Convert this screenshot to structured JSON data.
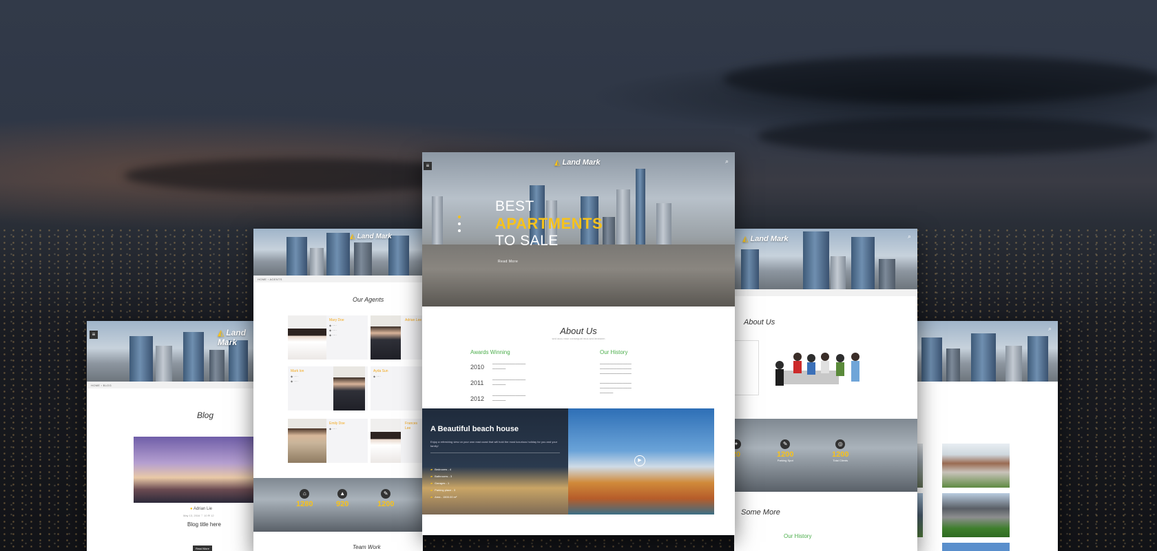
{
  "brand": {
    "name": "Land Mark",
    "accent": "#f7c21b",
    "green": "#4cae4c"
  },
  "icons": {
    "logo": "house-roof-icon",
    "menu": "hamburger-icon",
    "search": "search-icon",
    "play": "play-icon"
  },
  "center": {
    "hero": {
      "line1": "BEST",
      "line2": "APARTMENTS",
      "line3": "TO SALE",
      "read_more": "Read More"
    },
    "about": {
      "title": "About Us",
      "subtitle": "sed accu msn consequat mus sed leneanm",
      "awards_heading": "Awards Winning",
      "history_heading": "Our History",
      "years": [
        "2010",
        "2011",
        "2012"
      ]
    },
    "beach": {
      "title": "A Beautiful beach house",
      "description": "Enjoy a refreshing view on your own east coast that will hold the most luxurious holiday for you and your family!",
      "features": [
        "Bedrooms - 4",
        "Bathrooms - 3",
        "Garages - 1",
        "Parking place - 3",
        "Area - 1500.00 m²"
      ]
    }
  },
  "agents_page": {
    "breadcrumb": [
      "HOME",
      "AGENTS"
    ],
    "title": "Our Agents",
    "agent_names": [
      "Mary Doe",
      "Adrian Lee",
      "Mark Ion",
      "Ayda Sun",
      "Emily Doe",
      "Frances Lee"
    ],
    "stats": [
      "1280",
      "920",
      "1200"
    ]
  },
  "blog_page": {
    "breadcrumb": [
      "HOME",
      "BLOG"
    ],
    "title": "Blog",
    "author": "Adrian Lie",
    "meta": [
      "May 13, 2016",
      "10",
      "12"
    ],
    "post_title": "Blog title here",
    "read_more": "Read More"
  },
  "right_page": {
    "about_title": "About Us",
    "stats": [
      "20",
      "1200",
      "1200"
    ],
    "stat_labels": [
      "",
      "Parking Spot",
      "Total Clients"
    ],
    "some_more": "Some More",
    "history_heading": "Our History"
  },
  "far_left_bottom": {
    "team_title": "Team Work"
  }
}
